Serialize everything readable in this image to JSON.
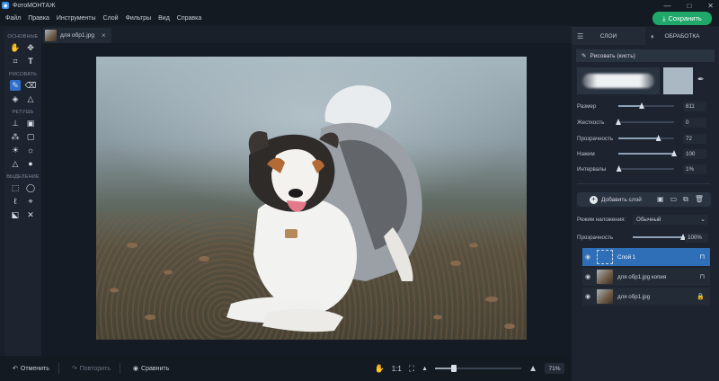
{
  "titlebar": {
    "app_title": "ФотоМОНТАЖ",
    "controls": [
      "—",
      "□",
      "✕"
    ]
  },
  "menu": [
    "Файл",
    "Правка",
    "Инструменты",
    "Слой",
    "Фильтры",
    "Вид",
    "Справка"
  ],
  "save_button": {
    "label": "Сохранить",
    "color": "#1fa86a"
  },
  "toolbar": {
    "sections": [
      {
        "title": "ОСНОВНЫЕ",
        "tools": [
          [
            "hand-icon",
            "move-icon"
          ],
          [
            "crop-icon",
            "text-icon"
          ]
        ]
      },
      {
        "title": "РИСОВАТЬ",
        "tools": [
          [
            "brush-icon",
            "eraser-icon"
          ],
          [
            "fill-icon",
            "shapes-icon"
          ]
        ]
      },
      {
        "title": "РЕТУШЬ",
        "tools": [
          [
            "stamp-icon",
            "patch-icon"
          ],
          [
            "pattern-icon",
            "frame-icon"
          ],
          [
            "dodge-icon",
            "burn-icon"
          ],
          [
            "sharpen-icon",
            "blur-icon"
          ]
        ]
      },
      {
        "title": "ВЫДЕЛЕНИЕ",
        "tools": [
          [
            "rect-select-icon",
            "ellipse-select-icon"
          ],
          [
            "lasso-icon",
            "poly-lasso-icon"
          ],
          [
            "magic-select-icon",
            "magic-wand-icon"
          ]
        ]
      }
    ],
    "active_tool": "brush-icon"
  },
  "document_tab": {
    "name": "для обр1.jpg",
    "close": "×"
  },
  "bottom": {
    "undo": "Отменить",
    "redo": "Повторить",
    "compare": "Сравнить",
    "ratio": "1:1",
    "zoom": "71%",
    "zoom_level": 0.71
  },
  "right_panel": {
    "tabs": [
      {
        "label": "СЛОИ",
        "active": false
      },
      {
        "label": "ОБРАБОТКА",
        "active": true
      }
    ],
    "brush_header": "Рисовать (кисть)",
    "brush_color": "#a9b8c2",
    "params": [
      {
        "label": "Размер",
        "value": "811",
        "level": 0.42
      },
      {
        "label": "Жесткость",
        "value": "0",
        "level": 0.0
      },
      {
        "label": "Прозрачность",
        "value": "72",
        "level": 0.72
      },
      {
        "label": "Нажим",
        "value": "100",
        "level": 1.0
      },
      {
        "label": "Интервалы",
        "value": "1%",
        "level": 0.01
      }
    ],
    "add_layer": "Добавить слой",
    "blend_label": "Режим наложения:",
    "blend_value": "Обычный",
    "opacity_label": "Прозрачность",
    "opacity_value": "100%",
    "opacity_level": 1.0,
    "layers": [
      {
        "name": "Слой 1",
        "selected": true,
        "locked": false
      },
      {
        "name": "для обр1.jpg копия",
        "selected": false,
        "locked": false
      },
      {
        "name": "для обр1.jpg",
        "selected": false,
        "locked": true
      }
    ]
  }
}
